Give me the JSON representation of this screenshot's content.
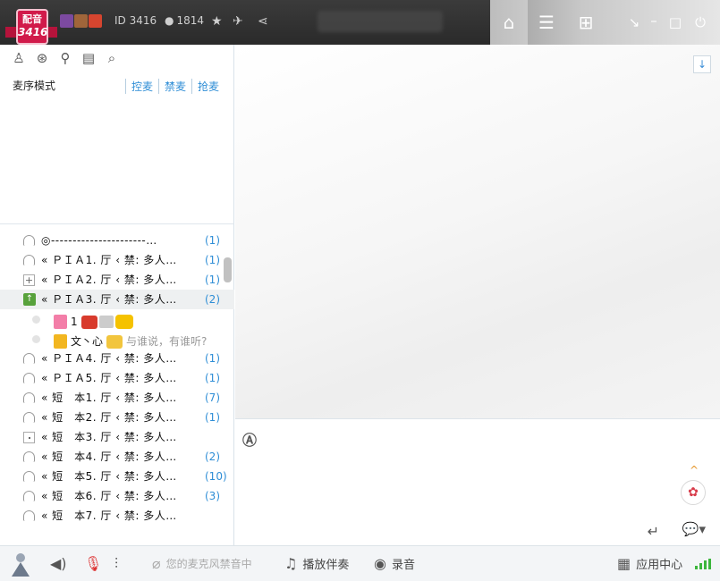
{
  "titlebar": {
    "logo_text": "配音",
    "logo_number": "3416",
    "id_label": "ID 3416",
    "member_count": "1814"
  },
  "left": {
    "mic_mode": "麦序模式",
    "links": [
      "控麦",
      "禁麦",
      "抢麦"
    ]
  },
  "channels": [
    {
      "name": "◎----------------------…",
      "count": "(1)",
      "icon": "headphone-icon",
      "selected": false
    },
    {
      "name": "« ＰＩＡ1. 厅 ‹ 禁: 多人…",
      "count": "(1)",
      "icon": "headphone-icon",
      "selected": false
    },
    {
      "name": "« ＰＩＡ2. 厅 ‹ 禁: 多人…",
      "count": "(1)",
      "icon": "plus-icon",
      "selected": false
    },
    {
      "name": "« ＰＩＡ3. 厅 ‹ 禁: 多人…",
      "count": "(2)",
      "icon": "green-mic-icon",
      "selected": true
    }
  ],
  "users": [
    {
      "name": "1",
      "tip": ""
    },
    {
      "name": "文丶心",
      "tip": "与谁说，有谁听?"
    }
  ],
  "channels2": [
    {
      "name": "« ＰＩＡ4. 厅 ‹ 禁: 多人…",
      "count": "(1)",
      "icon": "headphone-icon"
    },
    {
      "name": "« ＰＩＡ5. 厅 ‹ 禁: 多人…",
      "count": "(1)",
      "icon": "headphone-icon"
    },
    {
      "name": "« 短　本1. 厅 ‹ 禁: 多人…",
      "count": "(7)",
      "icon": "headphone-icon"
    },
    {
      "name": "« 短　本2. 厅 ‹ 禁: 多人…",
      "count": "(1)",
      "icon": "headphone-icon"
    },
    {
      "name": "« 短　本3. 厅 ‹ 禁: 多人…",
      "count": "",
      "icon": "dot-icon"
    },
    {
      "name": "« 短　本4. 厅 ‹ 禁: 多人…",
      "count": "(2)",
      "icon": "headphone-icon"
    },
    {
      "name": "« 短　本5. 厅 ‹ 禁: 多人…",
      "count": "(10)",
      "icon": "headphone-icon"
    },
    {
      "name": "« 短　本6. 厅 ‹ 禁: 多人…",
      "count": "(3)",
      "icon": "headphone-icon"
    },
    {
      "name": "« 短　本7. 厅 ‹ 禁: 多人…",
      "count": "",
      "icon": "headphone-icon"
    }
  ],
  "bottom": {
    "mic_muted": "您的麦克风禁音中",
    "play_accompaniment": "播放伴奏",
    "record": "录音",
    "app_center": "应用中心"
  }
}
